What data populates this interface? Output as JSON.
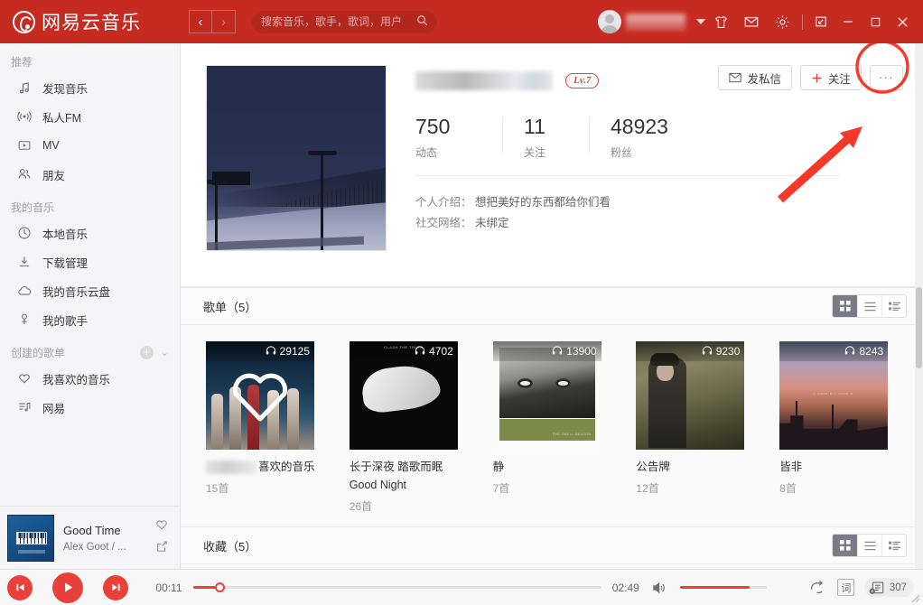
{
  "titlebar": {
    "brand": "网易云音乐",
    "nav_back": "‹",
    "nav_forward": "›",
    "search_placeholder": "搜索音乐，歌手，歌词，用户",
    "search_value": "",
    "icons": {
      "skin": "tshirt-icon",
      "mail": "mail-icon",
      "settings": "gear-icon",
      "mini": "minimize-to-mini-icon",
      "minimize": "minimize-icon",
      "maximize": "maximize-icon",
      "close": "close-icon"
    }
  },
  "sidebar": {
    "groups": [
      {
        "title": "推荐",
        "has_actions": false,
        "items": [
          {
            "label": "发现音乐",
            "icon": "music-note-icon"
          },
          {
            "label": "私人FM",
            "icon": "broadcast-icon"
          },
          {
            "label": "MV",
            "icon": "video-icon"
          },
          {
            "label": "朋友",
            "icon": "friends-icon"
          }
        ]
      },
      {
        "title": "我的音乐",
        "has_actions": false,
        "items": [
          {
            "label": "本地音乐",
            "icon": "clock-disc-icon"
          },
          {
            "label": "下载管理",
            "icon": "download-icon"
          },
          {
            "label": "我的音乐云盘",
            "icon": "cloud-icon"
          },
          {
            "label": "我的歌手",
            "icon": "singer-icon"
          }
        ]
      },
      {
        "title": "创建的歌单",
        "has_actions": true,
        "add_label": "+",
        "collapse_label": "⌄",
        "items": [
          {
            "label": "我喜欢的音乐",
            "icon": "heart-icon"
          },
          {
            "label": "网易",
            "icon": "playlist-note-icon"
          }
        ]
      }
    ]
  },
  "profile": {
    "avatar_alt": "snow-twilight-photo",
    "username_redacted": true,
    "level_badge": "Lv.7",
    "stats": [
      {
        "value": "750",
        "label": "动态"
      },
      {
        "value": "11",
        "label": "关注"
      },
      {
        "value": "48923",
        "label": "粉丝"
      }
    ],
    "fields": [
      {
        "key": "个人介绍：",
        "value": "想把美好的东西都给你们看"
      },
      {
        "key": "社交网络：",
        "value": "未绑定"
      }
    ],
    "actions": [
      {
        "label": "发私信",
        "icon": "mail-icon",
        "name": "send-message-button"
      },
      {
        "label": "关注",
        "icon": "plus-icon",
        "name": "follow-button"
      },
      {
        "label": "···",
        "icon": "more-icon",
        "name": "more-actions-button"
      }
    ]
  },
  "annotation": {
    "type": "red-arrow-and-ellipse",
    "color": "#f6372a",
    "target": "more-actions-button"
  },
  "sections": [
    {
      "title": "歌单（5）",
      "name": "playlists-section",
      "views": [
        {
          "name": "grid-view-button",
          "icon": "grid-icon",
          "active": true
        },
        {
          "name": "list-view-button",
          "icon": "list-icon",
          "active": false
        },
        {
          "name": "detail-view-button",
          "icon": "detail-list-icon",
          "active": false
        }
      ]
    },
    {
      "title": "收藏（5）",
      "name": "collections-section",
      "views": [
        {
          "name": "grid-view-button",
          "icon": "grid-icon",
          "active": true
        },
        {
          "name": "list-view-button",
          "icon": "list-icon",
          "active": false
        },
        {
          "name": "detail-view-button",
          "icon": "detail-list-icon",
          "active": false
        }
      ]
    }
  ],
  "playlists": [
    {
      "title_prefix_redacted": true,
      "title": "喜欢的音乐",
      "subtitle": "",
      "count": "15首",
      "plays": "29125",
      "cover": "fifth-harmony-cover",
      "has_heart_overlay": true
    },
    {
      "title_prefix_redacted": false,
      "title": "长于深夜 踏歌而眠",
      "subtitle": "Good Night",
      "count": "26首",
      "plays": "4702",
      "cover": "white-hand-cover",
      "has_heart_overlay": false
    },
    {
      "title_prefix_redacted": false,
      "title": "静",
      "subtitle": "",
      "count": "7首",
      "plays": "13900",
      "cover": "face-portrait-cover",
      "has_heart_overlay": false
    },
    {
      "title_prefix_redacted": false,
      "title": "公告牌",
      "subtitle": "",
      "count": "12首",
      "plays": "9230",
      "cover": "man-in-forest-cover",
      "has_heart_overlay": false
    },
    {
      "title_prefix_redacted": false,
      "title": "皆非",
      "subtitle": "",
      "count": "8首",
      "plays": "8243",
      "cover": "sunset-street-cover",
      "has_heart_overlay": false
    }
  ],
  "player": {
    "now_playing": {
      "title": "Good Time",
      "artist": "Alex Goot / ...",
      "cover": "blue-piano-cover",
      "like_icon": "heart-icon",
      "share_icon": "share-icon"
    },
    "controls": {
      "prev": "previous-track-icon",
      "play": "play-icon",
      "next": "next-track-icon"
    },
    "current_time": "00:11",
    "total_time": "02:49",
    "progress_percent": "6.5",
    "volume_icon": "volume-icon",
    "volume_percent": "80",
    "mode_icon": "repeat-icon",
    "lyrics_label": "词",
    "queue_icon": "playlist-queue-icon",
    "queue_count": "307"
  }
}
